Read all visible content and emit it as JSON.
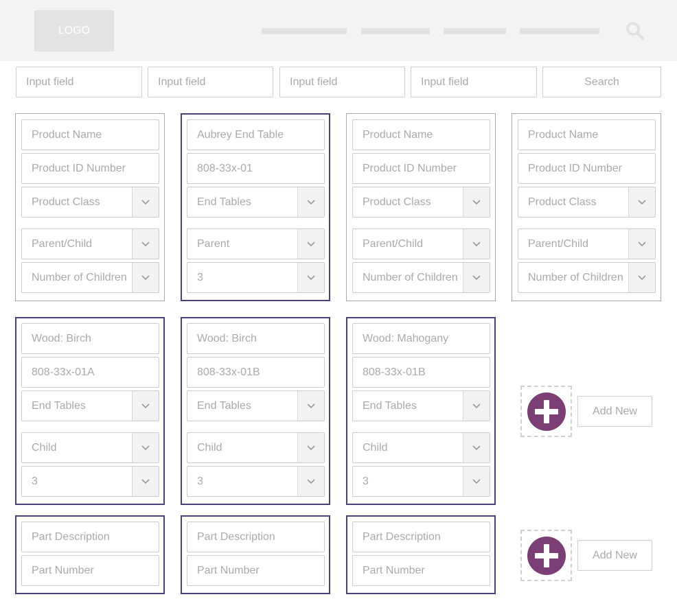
{
  "header": {
    "logo": "LOGO"
  },
  "search_bar": {
    "fields": [
      "Input field",
      "Input field",
      "Input field",
      "Input field"
    ],
    "search_label": "Search"
  },
  "parent_cards": [
    {
      "name": "Product Name",
      "id": "Product ID Number",
      "product_class": "Product Class",
      "parent_child": "Parent/Child",
      "children": "Number of Children",
      "selected": false
    },
    {
      "name": "Aubrey End Table",
      "id": "808-33x-01",
      "product_class": "End Tables",
      "parent_child": "Parent",
      "children": "3",
      "selected": true
    },
    {
      "name": "Product Name",
      "id": "Product ID Number",
      "product_class": "Product Class",
      "parent_child": "Parent/Child",
      "children": "Number of Children",
      "selected": false
    },
    {
      "name": "Product Name",
      "id": "Product ID Number",
      "product_class": "Product Class",
      "parent_child": "Parent/Child",
      "children": "Number of Children",
      "selected": false
    }
  ],
  "child_cards": [
    {
      "name": "Wood: Birch",
      "id": "808-33x-01A",
      "product_class": "End Tables",
      "parent_child": "Child",
      "children": "3"
    },
    {
      "name": "Wood: Birch",
      "id": "808-33x-01B",
      "product_class": "End Tables",
      "parent_child": "Child",
      "children": "3"
    },
    {
      "name": "Wood: Mahogany",
      "id": "808-33x-01B",
      "product_class": "End Tables",
      "parent_child": "Child",
      "children": "3"
    }
  ],
  "part_cards": [
    {
      "description": "Part Description",
      "number": "Part Number"
    },
    {
      "description": "Part Description",
      "number": "Part Number"
    },
    {
      "description": "Part Description",
      "number": "Part Number"
    }
  ],
  "add_new": {
    "child_label": "Add New",
    "part_label": "Add New",
    "icon": "plus-circle-icon",
    "color": "#7b3f76"
  },
  "colors": {
    "selected_border": "#4d3f7a",
    "header_bg": "#f3f3f3"
  }
}
